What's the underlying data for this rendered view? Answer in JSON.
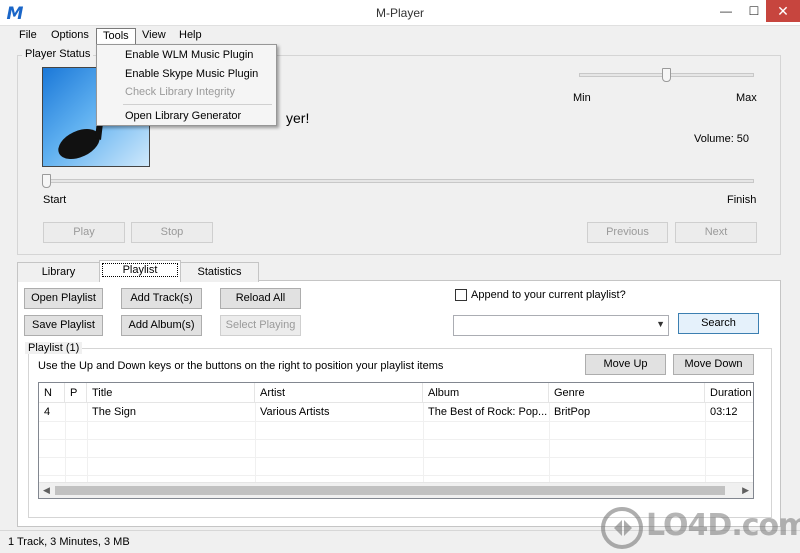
{
  "window": {
    "title": "M-Player",
    "min": "—",
    "max": "☐",
    "close": "✕"
  },
  "menubar": [
    "File",
    "Options",
    "Tools",
    "View",
    "Help"
  ],
  "tools_menu": {
    "items": [
      "Enable WLM Music Plugin",
      "Enable Skype Music Plugin",
      "Check Library Integrity",
      "Open Library Generator"
    ],
    "disabled": [
      false,
      false,
      true,
      false
    ]
  },
  "player_status": {
    "group_label": "Player Status",
    "welcome_fragment": "yer!",
    "volume_min": "Min",
    "volume_max": "Max",
    "volume_label": "Volume: 50",
    "volume_value": 50,
    "seek_start": "Start",
    "seek_finish": "Finish",
    "seek_position": 0,
    "buttons": {
      "play": "Play",
      "stop": "Stop",
      "previous": "Previous",
      "next": "Next"
    }
  },
  "tabs": {
    "library": "Library",
    "playlist": "Playlist",
    "statistics": "Statistics",
    "active": "playlist"
  },
  "playlist_panel": {
    "open": "Open Playlist",
    "save": "Save Playlist",
    "add_tracks": "Add Track(s)",
    "add_albums": "Add Album(s)",
    "reload_all": "Reload All",
    "select_playing": "Select Playing",
    "append_label": "Append to your current playlist?",
    "append_checked": false,
    "search": "Search",
    "search_value": "",
    "playlist_group_label": "Playlist (1)",
    "hint": "Use the Up and Down keys or the buttons on the right to position your playlist items",
    "move_up": "Move Up",
    "move_down": "Move Down"
  },
  "table": {
    "columns": [
      "N",
      "P",
      "Title",
      "Artist",
      "Album",
      "Genre",
      "Duration"
    ],
    "rows": [
      {
        "n": "4",
        "p": "",
        "title": "The Sign",
        "artist": "Various Artists",
        "album": "The Best of Rock: Pop...",
        "genre": "BritPop",
        "duration": "03:12"
      }
    ]
  },
  "status": "1 Track, 3 Minutes, 3 MB",
  "watermark": "LO4D.com"
}
